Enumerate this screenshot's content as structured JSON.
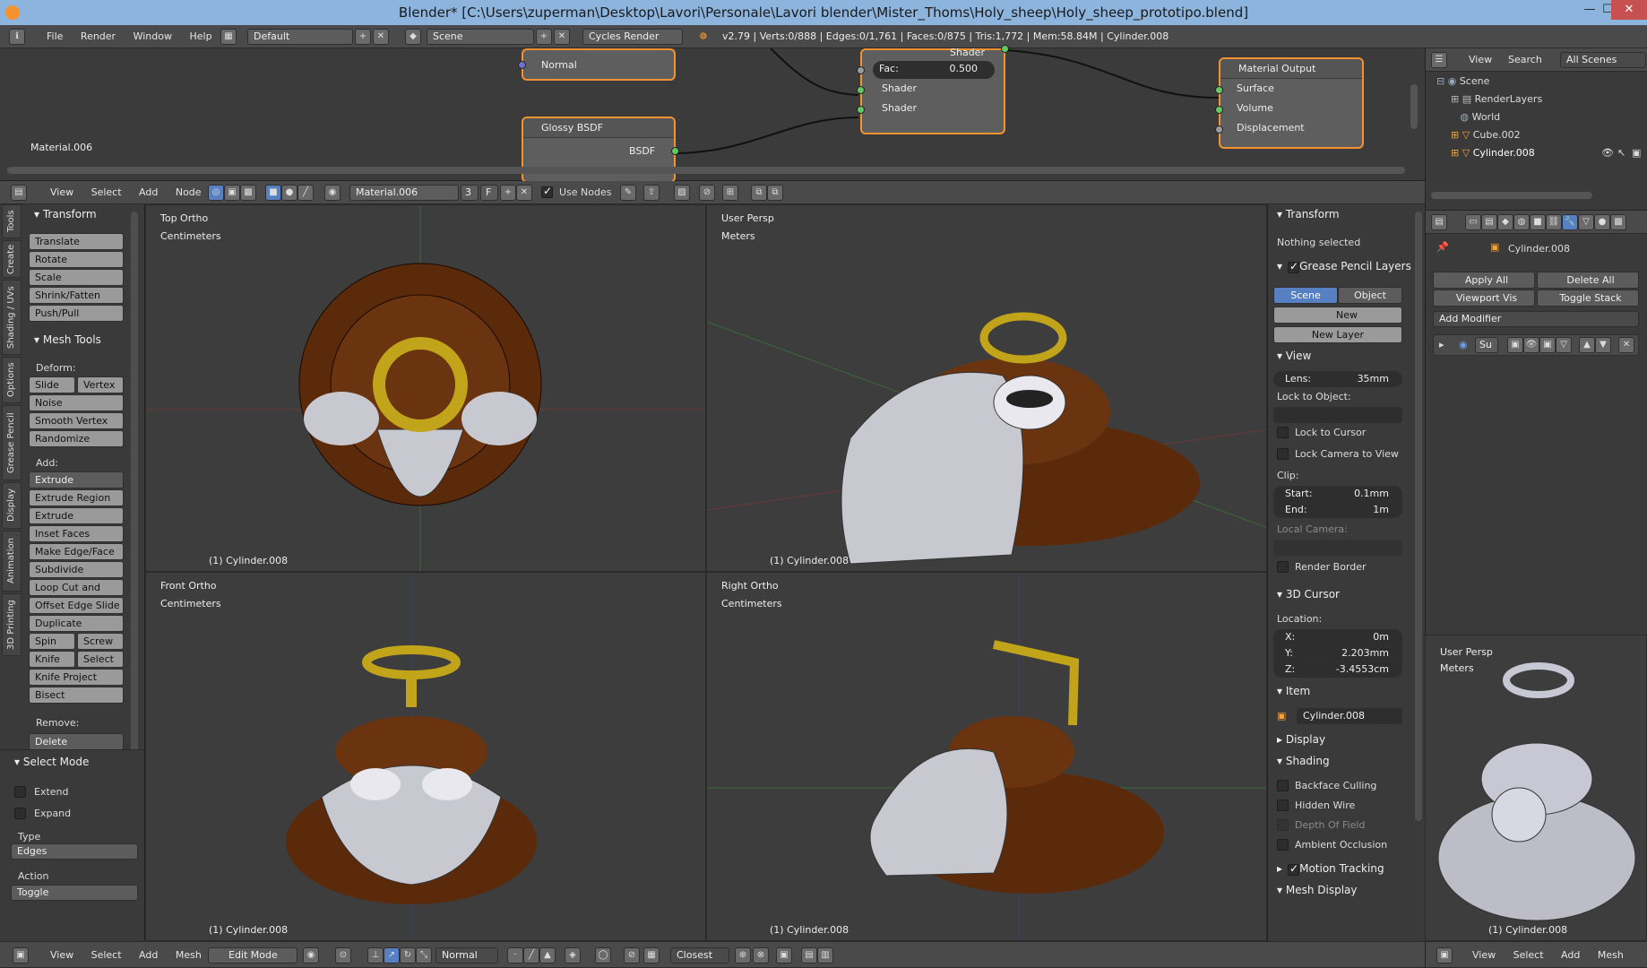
{
  "window": {
    "title": "Blender* [C:\\Users\\zuperman\\Desktop\\Lavori\\Personale\\Lavori blender\\Mister_Thoms\\Holy_sheep\\Holy_sheep_prototipo.blend]",
    "min": "—",
    "max": "☐",
    "close": "✕"
  },
  "info": {
    "menus": [
      "File",
      "Render",
      "Window",
      "Help"
    ],
    "layout": "Default",
    "scene": "Scene",
    "engine": "Cycles Render",
    "stats": "v2.79 | Verts:0/888 | Edges:0/1,761 | Faces:0/875 | Tris:1,772 | Mem:58.84M | Cylinder.008"
  },
  "node_editor": {
    "material_label": "Material.006",
    "normal": "Normal",
    "glossy_title": "Glossy BSDF",
    "bsdf": "BSDF",
    "mix_shader_out": "Shader",
    "fac_label": "Fac:",
    "fac_value": "0.500",
    "shader1": "Shader",
    "shader2": "Shader",
    "output_title": "Material Output",
    "surface": "Surface",
    "volume": "Volume",
    "displacement": "Displacement",
    "header": {
      "menus": [
        "View",
        "Select",
        "Add",
        "Node"
      ],
      "material": "Material.006",
      "users": "3",
      "fake": "F",
      "use_nodes": "Use Nodes"
    }
  },
  "outliner": {
    "menus": [
      "View",
      "Search"
    ],
    "filter": "All Scenes",
    "items": [
      "Scene",
      "RenderLayers",
      "World",
      "Cube.002",
      "Cylinder.008"
    ]
  },
  "tools_panel": {
    "tabs": [
      "Tools",
      "Create",
      "Shading / UVs",
      "Options",
      "Grease Pencil",
      "Display",
      "Animation",
      "3D Printing"
    ],
    "transform_title": "Transform",
    "transform": [
      "Translate",
      "Rotate",
      "Scale",
      "Shrink/Fatten",
      "Push/Pull"
    ],
    "mesh_tools_title": "Mesh Tools",
    "deform_label": "Deform:",
    "slide_edge": "Slide Ed",
    "vertex": "Vertex",
    "deform": [
      "Noise",
      "Smooth Vertex",
      "Randomize"
    ],
    "add_label": "Add:",
    "extrude": "Extrude",
    "add": [
      "Extrude Region",
      "Extrude Individual",
      "Inset Faces",
      "Make Edge/Face",
      "Subdivide",
      "Loop Cut and Slide",
      "Offset Edge Slide",
      "Duplicate"
    ],
    "spin": "Spin",
    "screw": "Screw",
    "knife": "Knife",
    "select": "Select",
    "knife_project": "Knife Project",
    "bisect": "Bisect",
    "remove_label": "Remove:",
    "delete": "Delete",
    "select_mode_title": "Select Mode",
    "extend": "Extend",
    "expand": "Expand",
    "type_label": "Type",
    "type_value": "Edges",
    "action_label": "Action",
    "action_value": "Toggle"
  },
  "viewports": [
    {
      "view": "Top Ortho",
      "units": "Centimeters",
      "object": "(1) Cylinder.008"
    },
    {
      "view": "User Persp",
      "units": "Meters",
      "object": "(1) Cylinder.008"
    },
    {
      "view": "Front Ortho",
      "units": "Centimeters",
      "object": "(1) Cylinder.008"
    },
    {
      "view": "Right Ortho",
      "units": "Centimeters",
      "object": "(1) Cylinder.008"
    }
  ],
  "properties_panel": {
    "transform_title": "Transform",
    "nothing_selected": "Nothing selected",
    "gp_layers": "Grease Pencil Layers",
    "scene": "Scene",
    "object": "Object",
    "new": "New",
    "new_layer": "New Layer",
    "view_title": "View",
    "lens_label": "Lens:",
    "lens_value": "35mm",
    "lock_to_object": "Lock to Object:",
    "lock_to_cursor": "Lock to Cursor",
    "lock_camera": "Lock Camera to View",
    "clip_label": "Clip:",
    "start_label": "Start:",
    "start_value": "0.1mm",
    "end_label": "End:",
    "end_value": "1m",
    "local_camera": "Local Camera:",
    "render_border": "Render Border",
    "cursor_title": "3D Cursor",
    "location_label": "Location:",
    "x_label": "X:",
    "x_value": "0m",
    "y_label": "Y:",
    "y_value": "2.203mm",
    "z_label": "Z:",
    "z_value": "-3.4553cm",
    "item_title": "Item",
    "item_name": "Cylinder.008",
    "display_title": "Display",
    "shading_title": "Shading",
    "backface": "Backface Culling",
    "hidden_wire": "Hidden Wire",
    "dof": "Depth Of Field",
    "ao": "Ambient Occlusion",
    "motion_tracking": "Motion Tracking",
    "mesh_display": "Mesh Display"
  },
  "modifiers": {
    "object_name": "Cylinder.008",
    "apply_all": "Apply All",
    "delete_all": "Delete All",
    "viewport_vis": "Viewport Vis",
    "toggle_stack": "Toggle Stack",
    "add_modifier": "Add Modifier",
    "su": "Su"
  },
  "mini_view": {
    "view": "User Persp",
    "units": "Meters",
    "object": "(1) Cylinder.008"
  },
  "footer": {
    "menus": [
      "View",
      "Select",
      "Add",
      "Mesh"
    ],
    "mode": "Edit Mode",
    "pivot": "Normal",
    "snap": "Closest"
  },
  "footer_right": {
    "menus": [
      "View",
      "Select",
      "Add",
      "Mesh"
    ]
  }
}
